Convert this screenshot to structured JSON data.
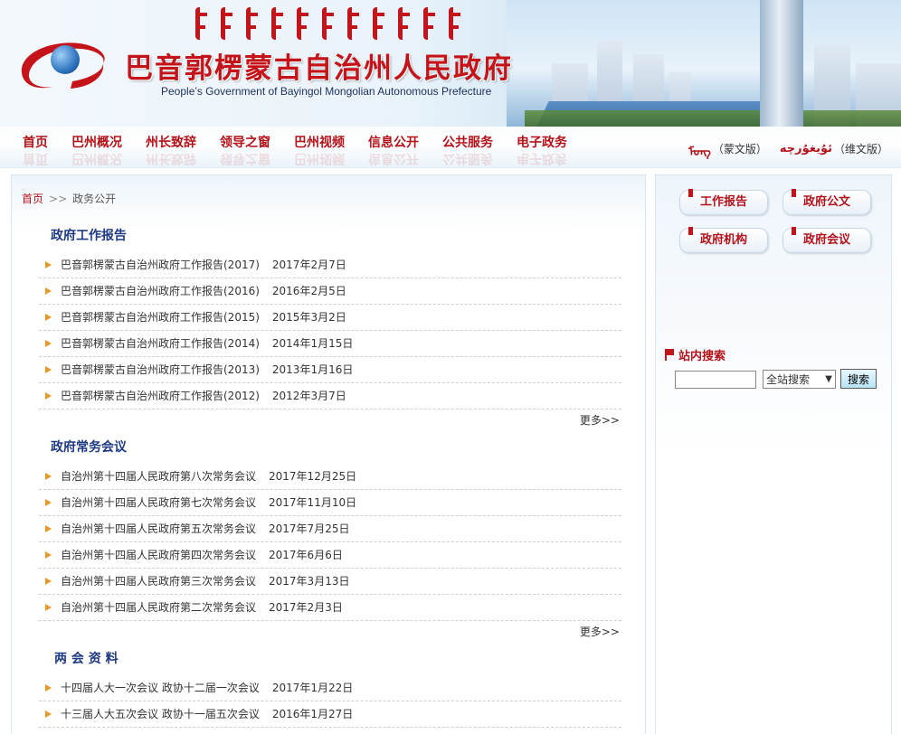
{
  "header": {
    "title": "巴音郭楞蒙古自治州人民政府",
    "subtitle": "People’s Government of Bayingol Mongolian Autonomous Prefecture"
  },
  "nav": {
    "items": [
      {
        "label": "首页"
      },
      {
        "label": "巴州概况"
      },
      {
        "label": "州长致辞"
      },
      {
        "label": "领导之窗"
      },
      {
        "label": "巴州视频"
      },
      {
        "label": "信息公开"
      },
      {
        "label": "公共服务"
      },
      {
        "label": "电子政务"
      }
    ],
    "lang": [
      {
        "glyph": "ᠮᠣᠩ",
        "label": "（蒙文版）"
      },
      {
        "glyph": "ئۇيغۇرچە",
        "label": "（维文版）"
      }
    ]
  },
  "breadcrumb": {
    "home": "首页",
    "sep": ">>",
    "current": "政务公开"
  },
  "sections": [
    {
      "title": "政府工作报告",
      "more": "更多>>",
      "items": [
        {
          "title": "巴音郭楞蒙古自治州政府工作报告(2017)",
          "date": "2017年2月7日"
        },
        {
          "title": "巴音郭楞蒙古自治州政府工作报告(2016)",
          "date": "2016年2月5日"
        },
        {
          "title": "巴音郭楞蒙古自治州政府工作报告(2015)",
          "date": "2015年3月2日"
        },
        {
          "title": "巴音郭楞蒙古自治州政府工作报告(2014)",
          "date": "2014年1月15日"
        },
        {
          "title": "巴音郭楞蒙古自治州政府工作报告(2013)",
          "date": "2013年1月16日"
        },
        {
          "title": "巴音郭楞蒙古自治州政府工作报告(2012)",
          "date": "2012年3月7日"
        }
      ]
    },
    {
      "title": "政府常务会议",
      "more": "更多>>",
      "items": [
        {
          "title": "自治州第十四届人民政府第八次常务会议",
          "date": "2017年12月25日"
        },
        {
          "title": "自治州第十四届人民政府第七次常务会议",
          "date": "2017年11月10日"
        },
        {
          "title": "自治州第十四届人民政府第五次常务会议",
          "date": "2017年7月25日"
        },
        {
          "title": "自治州第十四届人民政府第四次常务会议",
          "date": "2017年6月6日"
        },
        {
          "title": "自治州第十四届人民政府第三次常务会议",
          "date": "2017年3月13日"
        },
        {
          "title": "自治州第十四届人民政府第二次常务会议",
          "date": "2017年2月3日"
        }
      ]
    },
    {
      "title": "两 会 资 料",
      "items": [
        {
          "title": "十四届人大一次会议 政协十二届一次会议",
          "date": "2017年1月22日"
        },
        {
          "title": "十三届人大五次会议 政协十一届五次会议",
          "date": "2016年1月27日"
        }
      ]
    }
  ],
  "side": {
    "quick_links": [
      "工作报告",
      "政府公文",
      "政府机构",
      "政府会议"
    ],
    "search": {
      "heading": "站内搜索",
      "input_value": "",
      "scope_selected": "全站搜索",
      "button_label": "搜索"
    }
  },
  "colors": {
    "brand_red": "#b3121a",
    "section_blue": "#1f3a83",
    "bullet_orange": "#e39a2b"
  }
}
